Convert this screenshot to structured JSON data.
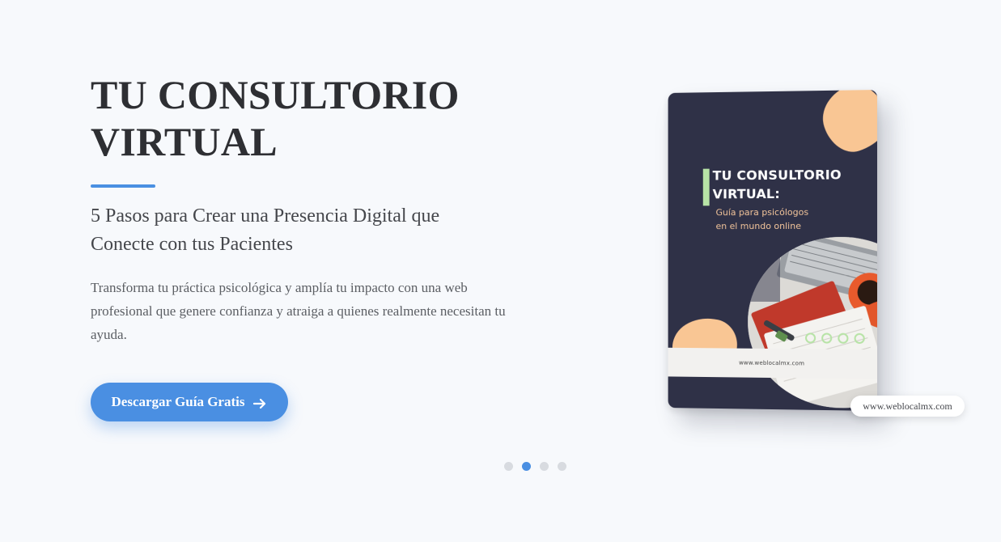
{
  "hero": {
    "title_line1": "TU CONSULTORIO",
    "title_line2": "VIRTUAL",
    "subtitle_line1": "5 Pasos para Crear una Presencia Digital que",
    "subtitle_line2": "Conecte con tus Pacientes",
    "description": "Transforma tu práctica psicológica y amplía tu impacto con una web profesional que genere confianza y atraiga a quienes realmente necesitan tu ayuda.",
    "cta_label": "Descargar Guía Gratis",
    "cta_icon": "arrow-right-icon"
  },
  "book": {
    "title_line1": "TU CONSULTORIO",
    "title_line2": "VIRTUAL:",
    "subtitle_line1": "Guía para psicólogos",
    "subtitle_line2": "en el mundo online",
    "footer_url": "www.weblocalmx.com",
    "background_color": "#2f3147",
    "accent_color": "#f9c694",
    "highlight_color": "#b7e3a6"
  },
  "badge": {
    "url": "www.weblocalmx.com"
  },
  "carousel": {
    "slide_count": 4,
    "active_index": 1
  },
  "colors": {
    "accent": "#4a8fe2",
    "title": "#2e2f33",
    "background": "#f7f9fc"
  }
}
